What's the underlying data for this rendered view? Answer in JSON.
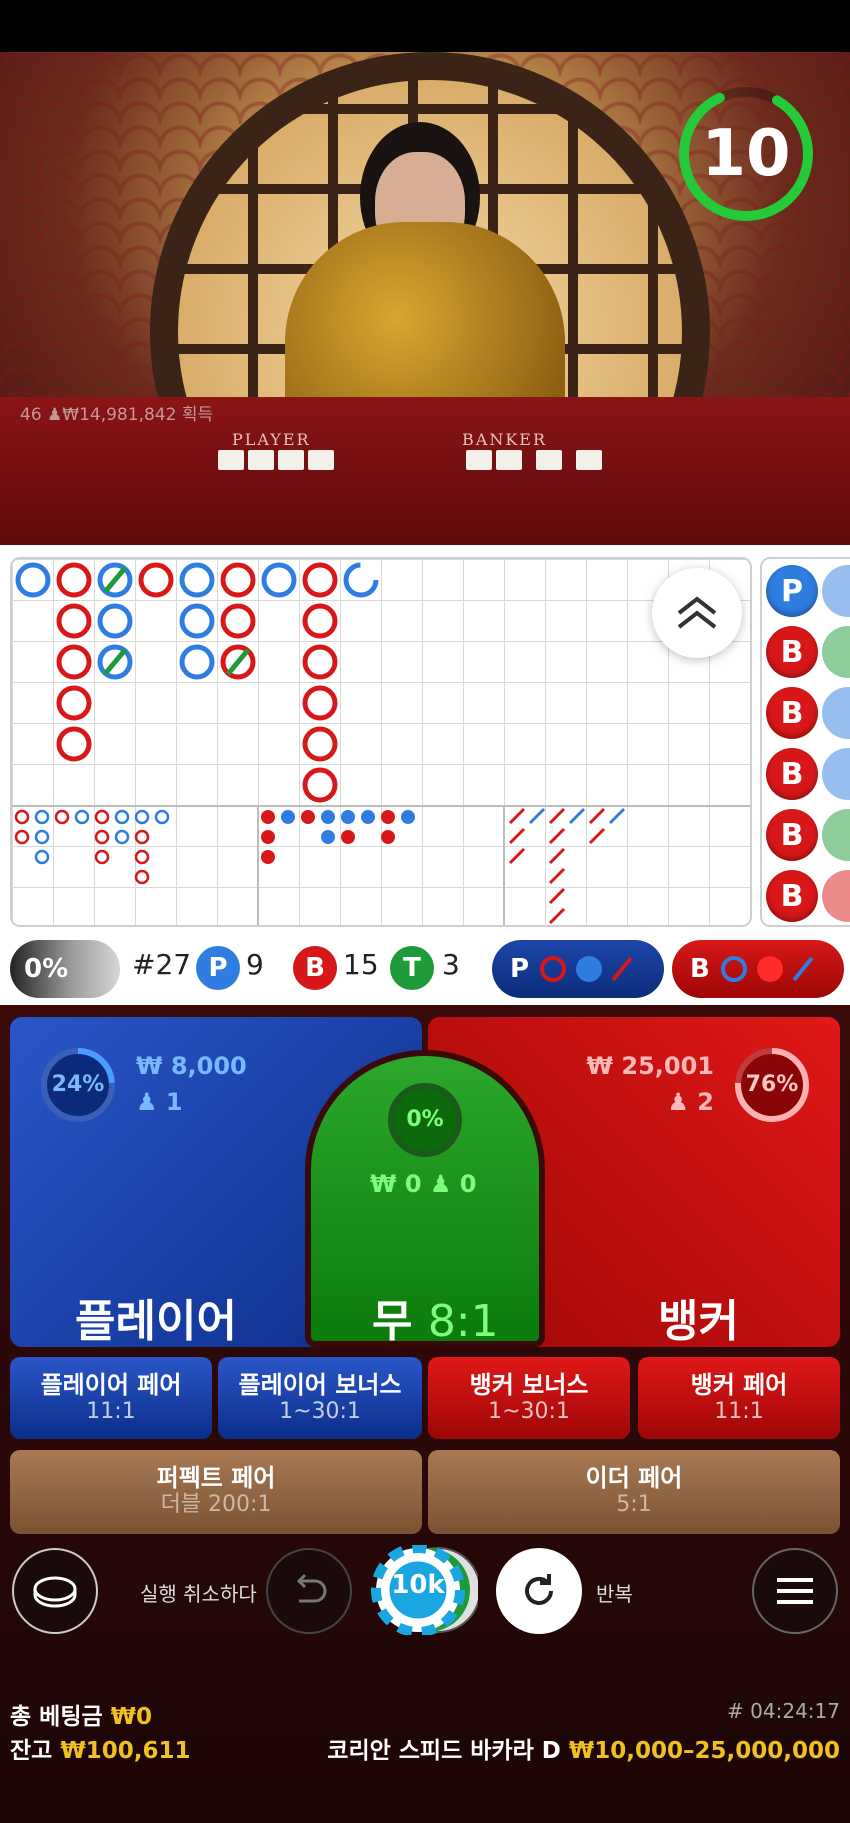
{
  "video": {
    "win_info": "46 ♟₩14,981,842 획득",
    "table_player": "PLAYER",
    "table_banker": "BANKER",
    "timer": "10"
  },
  "road": {
    "big_road_note": "bead road grid",
    "side_beads": [
      "P",
      "B",
      "B",
      "B",
      "B",
      "B"
    ]
  },
  "stats": {
    "percent": "0%",
    "round": "#27",
    "p_label": "P",
    "p_count": "9",
    "b_label": "B",
    "b_count": "15",
    "t_label": "T",
    "t_count": "3",
    "pred_p": "P",
    "pred_b": "B"
  },
  "bets": {
    "player": {
      "label": "플레이어",
      "percent": "24%",
      "amount": "₩ 8,000",
      "players": "1"
    },
    "tie": {
      "label": "무",
      "odds": "8:1",
      "percent": "0%",
      "amount": "₩ 0",
      "players": "0"
    },
    "banker": {
      "label": "뱅커",
      "percent": "76%",
      "amount": "₩ 25,001",
      "players": "2"
    },
    "player_pair": {
      "label": "플레이어 페어",
      "odds": "11:1"
    },
    "player_bonus": {
      "label": "플레이어 보너스",
      "odds": "1~30:1"
    },
    "banker_bonus": {
      "label": "뱅커 보너스",
      "odds": "1~30:1"
    },
    "banker_pair": {
      "label": "뱅커 페어",
      "odds": "11:1"
    },
    "perfect_pair": {
      "label": "퍼펙트 페어",
      "odds": "더블 200:1"
    },
    "either_pair": {
      "label": "이더 페어",
      "odds": "5:1"
    }
  },
  "controls": {
    "undo_label": "실행 취소하다",
    "chip_value": "10k",
    "repeat_label": "반복"
  },
  "footer": {
    "total_bet_label": "총 베팅금",
    "total_bet_value": "₩0",
    "balance_label": "잔고",
    "balance_value": "₩100,611",
    "round_id": "# 04:24:17",
    "table_name": "코리안 스피드 바카라 D",
    "limits": "₩10,000–25,000,000"
  },
  "colors": {
    "player": "#1f5fd6",
    "banker": "#d81818",
    "tie": "#1f9a3a",
    "gold": "#f0c020"
  }
}
